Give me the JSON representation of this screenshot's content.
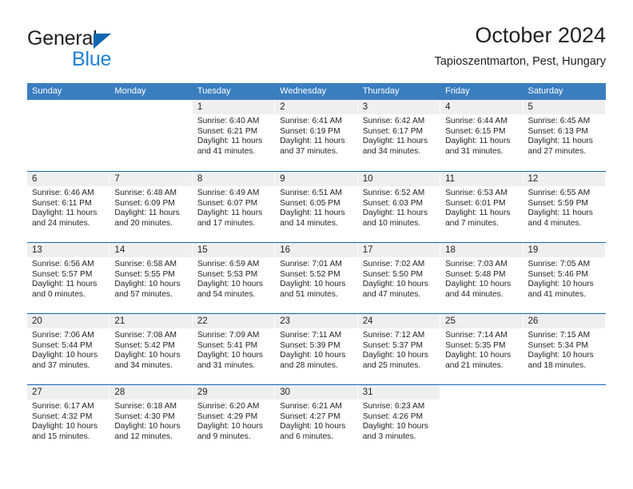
{
  "logo": {
    "name_top": "General",
    "name_bottom": "Blue",
    "triangle_icon": "triangle-icon",
    "color_dark": "#231f20",
    "color_blue": "#1f80d0"
  },
  "header": {
    "title": "October 2024",
    "subtitle": "Tapioszentmarton, Pest, Hungary"
  },
  "theme": {
    "header_bar": "#3a7ec0",
    "row_rule": "#1266b0",
    "daynum_band": "#efefef",
    "text": "#231f20"
  },
  "weekdays": [
    "Sunday",
    "Monday",
    "Tuesday",
    "Wednesday",
    "Thursday",
    "Friday",
    "Saturday"
  ],
  "weeks": [
    [
      {
        "day": "",
        "sunrise": "",
        "sunset": "",
        "daylight1": "",
        "daylight2": ""
      },
      {
        "day": "",
        "sunrise": "",
        "sunset": "",
        "daylight1": "",
        "daylight2": ""
      },
      {
        "day": "1",
        "sunrise": "Sunrise: 6:40 AM",
        "sunset": "Sunset: 6:21 PM",
        "daylight1": "Daylight: 11 hours",
        "daylight2": "and 41 minutes."
      },
      {
        "day": "2",
        "sunrise": "Sunrise: 6:41 AM",
        "sunset": "Sunset: 6:19 PM",
        "daylight1": "Daylight: 11 hours",
        "daylight2": "and 37 minutes."
      },
      {
        "day": "3",
        "sunrise": "Sunrise: 6:42 AM",
        "sunset": "Sunset: 6:17 PM",
        "daylight1": "Daylight: 11 hours",
        "daylight2": "and 34 minutes."
      },
      {
        "day": "4",
        "sunrise": "Sunrise: 6:44 AM",
        "sunset": "Sunset: 6:15 PM",
        "daylight1": "Daylight: 11 hours",
        "daylight2": "and 31 minutes."
      },
      {
        "day": "5",
        "sunrise": "Sunrise: 6:45 AM",
        "sunset": "Sunset: 6:13 PM",
        "daylight1": "Daylight: 11 hours",
        "daylight2": "and 27 minutes."
      }
    ],
    [
      {
        "day": "6",
        "sunrise": "Sunrise: 6:46 AM",
        "sunset": "Sunset: 6:11 PM",
        "daylight1": "Daylight: 11 hours",
        "daylight2": "and 24 minutes."
      },
      {
        "day": "7",
        "sunrise": "Sunrise: 6:48 AM",
        "sunset": "Sunset: 6:09 PM",
        "daylight1": "Daylight: 11 hours",
        "daylight2": "and 20 minutes."
      },
      {
        "day": "8",
        "sunrise": "Sunrise: 6:49 AM",
        "sunset": "Sunset: 6:07 PM",
        "daylight1": "Daylight: 11 hours",
        "daylight2": "and 17 minutes."
      },
      {
        "day": "9",
        "sunrise": "Sunrise: 6:51 AM",
        "sunset": "Sunset: 6:05 PM",
        "daylight1": "Daylight: 11 hours",
        "daylight2": "and 14 minutes."
      },
      {
        "day": "10",
        "sunrise": "Sunrise: 6:52 AM",
        "sunset": "Sunset: 6:03 PM",
        "daylight1": "Daylight: 11 hours",
        "daylight2": "and 10 minutes."
      },
      {
        "day": "11",
        "sunrise": "Sunrise: 6:53 AM",
        "sunset": "Sunset: 6:01 PM",
        "daylight1": "Daylight: 11 hours",
        "daylight2": "and 7 minutes."
      },
      {
        "day": "12",
        "sunrise": "Sunrise: 6:55 AM",
        "sunset": "Sunset: 5:59 PM",
        "daylight1": "Daylight: 11 hours",
        "daylight2": "and 4 minutes."
      }
    ],
    [
      {
        "day": "13",
        "sunrise": "Sunrise: 6:56 AM",
        "sunset": "Sunset: 5:57 PM",
        "daylight1": "Daylight: 11 hours",
        "daylight2": "and 0 minutes."
      },
      {
        "day": "14",
        "sunrise": "Sunrise: 6:58 AM",
        "sunset": "Sunset: 5:55 PM",
        "daylight1": "Daylight: 10 hours",
        "daylight2": "and 57 minutes."
      },
      {
        "day": "15",
        "sunrise": "Sunrise: 6:59 AM",
        "sunset": "Sunset: 5:53 PM",
        "daylight1": "Daylight: 10 hours",
        "daylight2": "and 54 minutes."
      },
      {
        "day": "16",
        "sunrise": "Sunrise: 7:01 AM",
        "sunset": "Sunset: 5:52 PM",
        "daylight1": "Daylight: 10 hours",
        "daylight2": "and 51 minutes."
      },
      {
        "day": "17",
        "sunrise": "Sunrise: 7:02 AM",
        "sunset": "Sunset: 5:50 PM",
        "daylight1": "Daylight: 10 hours",
        "daylight2": "and 47 minutes."
      },
      {
        "day": "18",
        "sunrise": "Sunrise: 7:03 AM",
        "sunset": "Sunset: 5:48 PM",
        "daylight1": "Daylight: 10 hours",
        "daylight2": "and 44 minutes."
      },
      {
        "day": "19",
        "sunrise": "Sunrise: 7:05 AM",
        "sunset": "Sunset: 5:46 PM",
        "daylight1": "Daylight: 10 hours",
        "daylight2": "and 41 minutes."
      }
    ],
    [
      {
        "day": "20",
        "sunrise": "Sunrise: 7:06 AM",
        "sunset": "Sunset: 5:44 PM",
        "daylight1": "Daylight: 10 hours",
        "daylight2": "and 37 minutes."
      },
      {
        "day": "21",
        "sunrise": "Sunrise: 7:08 AM",
        "sunset": "Sunset: 5:42 PM",
        "daylight1": "Daylight: 10 hours",
        "daylight2": "and 34 minutes."
      },
      {
        "day": "22",
        "sunrise": "Sunrise: 7:09 AM",
        "sunset": "Sunset: 5:41 PM",
        "daylight1": "Daylight: 10 hours",
        "daylight2": "and 31 minutes."
      },
      {
        "day": "23",
        "sunrise": "Sunrise: 7:11 AM",
        "sunset": "Sunset: 5:39 PM",
        "daylight1": "Daylight: 10 hours",
        "daylight2": "and 28 minutes."
      },
      {
        "day": "24",
        "sunrise": "Sunrise: 7:12 AM",
        "sunset": "Sunset: 5:37 PM",
        "daylight1": "Daylight: 10 hours",
        "daylight2": "and 25 minutes."
      },
      {
        "day": "25",
        "sunrise": "Sunrise: 7:14 AM",
        "sunset": "Sunset: 5:35 PM",
        "daylight1": "Daylight: 10 hours",
        "daylight2": "and 21 minutes."
      },
      {
        "day": "26",
        "sunrise": "Sunrise: 7:15 AM",
        "sunset": "Sunset: 5:34 PM",
        "daylight1": "Daylight: 10 hours",
        "daylight2": "and 18 minutes."
      }
    ],
    [
      {
        "day": "27",
        "sunrise": "Sunrise: 6:17 AM",
        "sunset": "Sunset: 4:32 PM",
        "daylight1": "Daylight: 10 hours",
        "daylight2": "and 15 minutes."
      },
      {
        "day": "28",
        "sunrise": "Sunrise: 6:18 AM",
        "sunset": "Sunset: 4:30 PM",
        "daylight1": "Daylight: 10 hours",
        "daylight2": "and 12 minutes."
      },
      {
        "day": "29",
        "sunrise": "Sunrise: 6:20 AM",
        "sunset": "Sunset: 4:29 PM",
        "daylight1": "Daylight: 10 hours",
        "daylight2": "and 9 minutes."
      },
      {
        "day": "30",
        "sunrise": "Sunrise: 6:21 AM",
        "sunset": "Sunset: 4:27 PM",
        "daylight1": "Daylight: 10 hours",
        "daylight2": "and 6 minutes."
      },
      {
        "day": "31",
        "sunrise": "Sunrise: 6:23 AM",
        "sunset": "Sunset: 4:26 PM",
        "daylight1": "Daylight: 10 hours",
        "daylight2": "and 3 minutes."
      },
      {
        "day": "",
        "sunrise": "",
        "sunset": "",
        "daylight1": "",
        "daylight2": ""
      },
      {
        "day": "",
        "sunrise": "",
        "sunset": "",
        "daylight1": "",
        "daylight2": ""
      }
    ]
  ]
}
